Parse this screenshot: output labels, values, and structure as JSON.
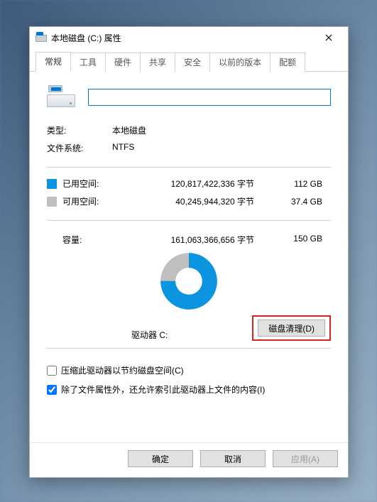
{
  "window": {
    "title": "本地磁盘 (C:) 属性",
    "close_tooltip": "关闭"
  },
  "tabs": [
    {
      "label": "常规",
      "active": true
    },
    {
      "label": "工具",
      "active": false
    },
    {
      "label": "硬件",
      "active": false
    },
    {
      "label": "共享",
      "active": false
    },
    {
      "label": "安全",
      "active": false
    },
    {
      "label": "以前的版本",
      "active": false
    },
    {
      "label": "配额",
      "active": false
    }
  ],
  "name_field": {
    "value": "",
    "placeholder": ""
  },
  "type": {
    "label": "类型:",
    "value": "本地磁盘"
  },
  "filesystem": {
    "label": "文件系统:",
    "value": "NTFS"
  },
  "used": {
    "label": "已用空间:",
    "bytes": "120,817,422,336 字节",
    "human": "112 GB",
    "swatch_color": "#0b94e0"
  },
  "free": {
    "label": "可用空间:",
    "bytes": "40,245,944,320 字节",
    "human": "37.4 GB",
    "swatch_color": "#bfbfbf"
  },
  "capacity": {
    "label": "容量:",
    "bytes": "161,063,366,656 字节",
    "human": "150 GB"
  },
  "drive_label": "驱动器 C:",
  "disk_cleanup": "磁盘清理(D)",
  "checkbox_compress": {
    "label": "压缩此驱动器以节约磁盘空间(C)",
    "checked": false
  },
  "checkbox_index": {
    "label": "除了文件属性外，还允许索引此驱动器上文件的内容(I)",
    "checked": true
  },
  "buttons": {
    "ok": "确定",
    "cancel": "取消",
    "apply": "应用(A)"
  },
  "chart_data": {
    "type": "pie",
    "title": "驱动器 C:",
    "series": [
      {
        "name": "已用空间",
        "value": 120817422336,
        "color": "#0b94e0"
      },
      {
        "name": "可用空间",
        "value": 40245944320,
        "color": "#bfbfbf"
      }
    ],
    "used_fraction": 0.75
  }
}
